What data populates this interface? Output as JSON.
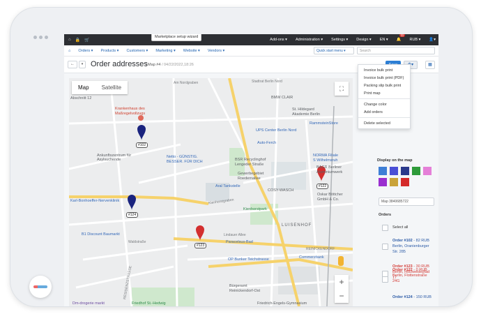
{
  "topbar": {
    "wizard_tip": "Marketplace setup wizard",
    "menus": [
      "Add-ons ▾",
      "Administration ▾",
      "Settings ▾",
      "Design ▾",
      "EN ▾"
    ],
    "notif_count": "11",
    "currency": "RUB ▾"
  },
  "nav": {
    "items": [
      "Orders ▾",
      "Products ▾",
      "Customers ▾",
      "Marketing ▾",
      "Website ▾",
      "Vendors ▾"
    ],
    "quick_start": "Quick start menu ▾",
    "search_placeholder": "Search"
  },
  "header": {
    "title": "Order addresses",
    "breadcrumb": "/ Map #4",
    "datetime": "/ 04/22/2022,18:26",
    "save_label": "Save"
  },
  "map": {
    "tab_map": "Map",
    "tab_satellite": "Satellite",
    "pins": [
      {
        "label": "#102",
        "color": "#1a237e"
      },
      {
        "label": "#124",
        "color": "#1a237e"
      },
      {
        "label": "#122",
        "color": "#d32f2f"
      },
      {
        "label": "#123",
        "color": "#d32f2f"
      }
    ],
    "labels": {
      "l1": "Abschnitt 12",
      "l2": "Krankenhaus des",
      "l3": "Maßregelvollzugs",
      "l4": "Ankunftszentrum für Asylsuchende",
      "l5": "Netto - GÜNSTIG.",
      "l6": "BESSER. FÜR DICH",
      "l7": "BSR Recyclinghof",
      "l8": "Lengeder Straße",
      "l9": "Gewerbegebiet",
      "l10": "Roedernallee",
      "l11": "UPS Center Berlin Nord",
      "l12": "Auto-Ferch",
      "l13": "St. Hildegard",
      "l14": "Akademie Berlin",
      "l15": "RammsteinStore",
      "l16": "BMW CLAIR",
      "l17": "NORMA Filiale",
      "l18": "S Wilhelmsruh",
      "l19": "BAGR Berliner",
      "l20": "Aluminiumwerk",
      "l21": "Aral Tankstelle",
      "l22": "COSY-WASCH",
      "l23": "Oskar Böttcher",
      "l24": "GmbH & Co.",
      "l25": "Karl-Bonhoeffer-Nervenklinik",
      "l26": "Kienhorstpark",
      "l27": "LUISENHOF",
      "l28": "B1 Discount Baumarkt",
      "l29": "Waldstraße",
      "l30": "Paracelsus-Bad",
      "l31": "Lindauer Allee",
      "l32": "OP Bunker Teichstrasse",
      "l33": "Commerzbank",
      "l34": "Bürgeramt",
      "l35": "Reinickendorf-Ost",
      "l36": "Friedhof St.-Hedwig",
      "l37": "Friedrich-Engels-Gymnasium",
      "l38": "Dm-drogerie markt",
      "l39": "RESIDENZSTRASSE",
      "l40": "REINICKENDORF",
      "l41": "Kienhorstgraben",
      "l42": "Am Nordgraben",
      "l43": "Stadtrat Berlin Nord"
    }
  },
  "menu": {
    "items": [
      "Invoice bulk print",
      "Invoice bulk print (PDF)",
      "Packing slip bulk print",
      "Print map",
      "Change color",
      "Add orders",
      "Delete selected"
    ]
  },
  "panel": {
    "display_heading": "Display on the map",
    "colors": [
      "#3e7fd6",
      "#4a4fd6",
      "#2a3a8c",
      "#2e9b3a",
      "#e580d8",
      "#9a2fd0",
      "#c9a33a",
      "#d42a2a"
    ],
    "map_name": "Map 3840685722",
    "orders_heading": "Orders",
    "select_all": "Select all",
    "orders": [
      {
        "title": "Order #102",
        "amount": " - 82 RUB",
        "addr": "Berlin, Oranienburger Str. 285"
      },
      {
        "title": "Order #122",
        "amount": " - 0 RUB",
        "addr": "Berlin, Flottenstraße 24G"
      },
      {
        "title": "Order #123",
        "amount": " - 30 RUB",
        "addr": "Berlin, Holzweidepfad 17"
      },
      {
        "title": "Order #124",
        "amount": " - 150 RUB",
        "addr": ""
      }
    ]
  }
}
